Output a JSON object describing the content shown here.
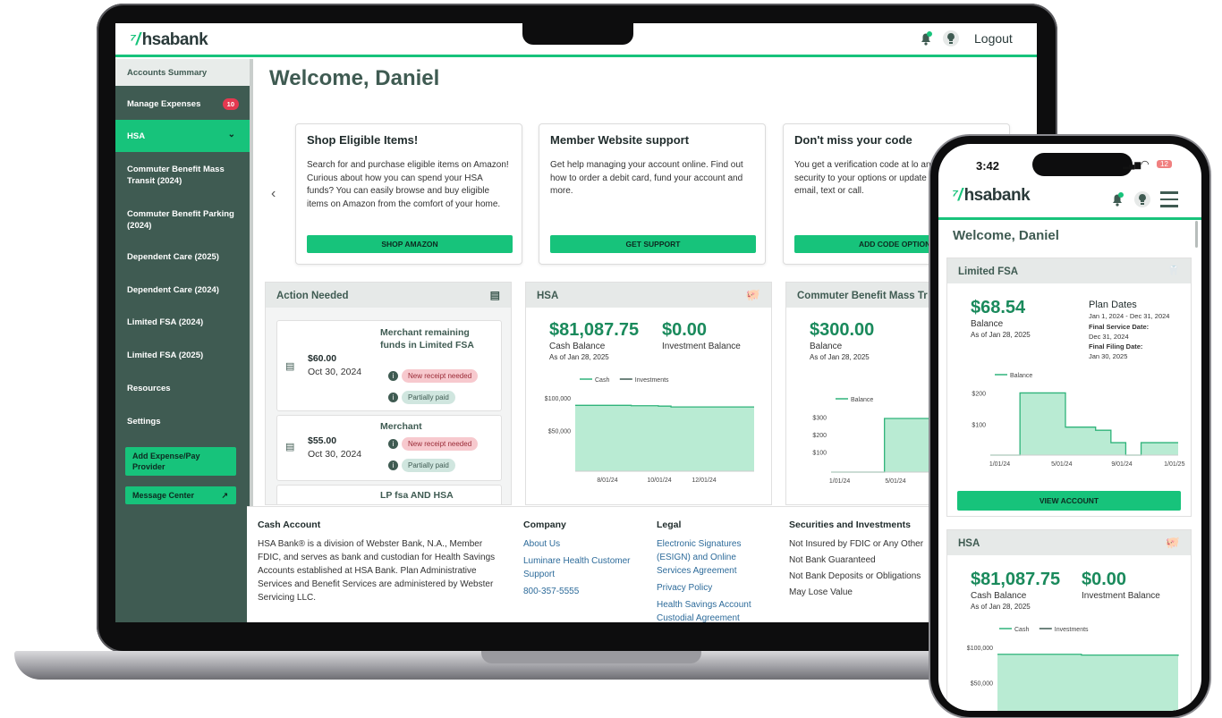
{
  "app": {
    "brand": "hsabank",
    "logout": "Logout"
  },
  "sidebar": {
    "items": [
      {
        "label": "Accounts Summary"
      },
      {
        "label": "Manage Expenses",
        "badge": "10"
      },
      {
        "label": "HSA"
      },
      {
        "label": "Commuter Benefit Mass Transit (2024)"
      },
      {
        "label": "Commuter Benefit Parking (2024)"
      },
      {
        "label": "Dependent Care (2025)"
      },
      {
        "label": "Dependent Care (2024)"
      },
      {
        "label": "Limited FSA (2024)"
      },
      {
        "label": "Limited FSA (2025)"
      },
      {
        "label": "Resources"
      },
      {
        "label": "Settings"
      }
    ],
    "add_expense": "Add Expense/Pay Provider",
    "message_center": "Message Center"
  },
  "main": {
    "welcome": "Welcome, Daniel",
    "promos": [
      {
        "title": "Shop Eligible Items!",
        "body": "Search for and purchase eligible items on Amazon! Curious about how you can spend your HSA funds? You can easily browse and buy eligible items on Amazon from the comfort of your home.",
        "button": "SHOP AMAZON"
      },
      {
        "title": "Member Website support",
        "body": "Get help managing your account online. Find out how to order a debit card, fund your account and more.",
        "button": "GET SUPPORT"
      },
      {
        "title": "Don't miss your code",
        "body": "You get a verification code at lo another layer of security to your options or update how you get y email, text or call.",
        "button": "ADD CODE OPTIONS"
      }
    ],
    "action_needed": {
      "title": "Action Needed",
      "items": [
        {
          "amount": "$60.00",
          "date": "Oct 30, 2024",
          "merchant": "Merchant remaining funds in Limited FSA",
          "tag1": "New receipt needed",
          "tag2": "Partially paid"
        },
        {
          "amount": "$55.00",
          "date": "Oct 30, 2024",
          "merchant": "Merchant",
          "tag1": "New receipt needed",
          "tag2": "Partially paid"
        },
        {
          "merchant": "LP fsa AND HSA"
        }
      ]
    },
    "hsa": {
      "title": "HSA",
      "cash": "$81,087.75",
      "cash_label": "Cash Balance",
      "asof": "As of Jan 28, 2025",
      "invest": "$0.00",
      "invest_label": "Investment Balance"
    },
    "commuter": {
      "title": "Commuter Benefit Mass Tr",
      "balance": "$300.00",
      "balance_label": "Balance",
      "asof": "As of Jan 28, 2025"
    }
  },
  "footer": {
    "cash_account": {
      "title": "Cash Account",
      "text": "HSA Bank® is a division of Webster Bank, N.A., Member FDIC, and serves as bank and custodian for Health Savings Accounts established at HSA Bank. Plan Administrative Services and Benefit Services are administered by Webster Servicing LLC."
    },
    "company": {
      "title": "Company",
      "links": [
        "About Us",
        "Luminare Health Customer Support",
        "800-357-5555"
      ]
    },
    "legal": {
      "title": "Legal",
      "links": [
        "Electronic Signatures (ESIGN) and Online Services Agreement",
        "Privacy Policy",
        "Health Savings Account Custodial Agreement"
      ]
    },
    "securities": {
      "title": "Securities and Investments",
      "lines": [
        "Not Insured by FDIC or Any Other",
        "Not Bank Guaranteed",
        "Not Bank Deposits or Obligations",
        "May Lose Value"
      ]
    }
  },
  "phone": {
    "time": "3:42",
    "battery": "12",
    "welcome": "Welcome, Daniel",
    "limited_fsa": {
      "title": "Limited FSA",
      "balance": "$68.54",
      "balance_label": "Balance",
      "asof": "As of Jan 28, 2025",
      "plan_dates_title": "Plan Dates",
      "plan_dates": "Jan 1, 2024 - Dec 31, 2024",
      "final_service_label": "Final Service Date:",
      "final_service": "Dec 31, 2024",
      "final_filing_label": "Final Filing Date:",
      "final_filing": "Jan 30, 2025",
      "button": "VIEW ACCOUNT"
    },
    "hsa": {
      "title": "HSA",
      "cash": "$81,087.75",
      "cash_label": "Cash Balance",
      "asof": "As of Jan 28, 2025",
      "invest": "$0.00",
      "invest_label": "Investment Balance"
    }
  },
  "colors": {
    "accent": "#17c37b",
    "sidebar": "#3f5b52",
    "money": "#1a8a5c"
  },
  "chart_data": [
    {
      "type": "area",
      "legend": [
        "Cash",
        "Investments"
      ],
      "yticks": [
        "$100,000",
        "$50,000"
      ],
      "xticks": [
        "8/01/24",
        "10/01/24",
        "12/01/24"
      ],
      "ylim": [
        0,
        100000
      ],
      "series": [
        {
          "name": "Cash",
          "x": [
            "7/01/24",
            "8/01/24",
            "9/01/24",
            "10/01/24",
            "10/15/24",
            "11/01/24",
            "12/01/24",
            "1/15/25"
          ],
          "values": [
            81000,
            81000,
            80500,
            80000,
            79000,
            79000,
            79000,
            79000
          ]
        }
      ]
    },
    {
      "type": "area",
      "legend": [
        "Balance"
      ],
      "yticks": [
        "$300",
        "$200",
        "$100"
      ],
      "xticks": [
        "1/01/24",
        "5/01/24",
        "9/0"
      ],
      "ylim": [
        0,
        350
      ],
      "series": [
        {
          "name": "Balance",
          "x": [
            "1/01/24",
            "3/01/24",
            "4/01/24",
            "9/01/24"
          ],
          "values": [
            0,
            0,
            300,
            300
          ]
        }
      ]
    },
    {
      "type": "area",
      "legend": [
        "Balance"
      ],
      "yticks": [
        "$200",
        "$100"
      ],
      "xticks": [
        "1/01/24",
        "5/01/24",
        "9/01/24",
        "1/01/25"
      ],
      "ylim": [
        0,
        230
      ],
      "series": [
        {
          "name": "Balance",
          "x": [
            "1/01/24",
            "3/01/24",
            "5/01/24",
            "6/01/24",
            "8/01/24",
            "9/01/24",
            "10/01/24",
            "11/01/24",
            "12/01/24"
          ],
          "values": [
            0,
            200,
            200,
            90,
            80,
            40,
            0,
            40,
            40
          ]
        }
      ]
    },
    {
      "type": "area",
      "legend": [
        "Cash",
        "Investments"
      ],
      "yticks": [
        "$100,000",
        "$50,000"
      ],
      "ylim": [
        0,
        100000
      ],
      "series": [
        {
          "name": "Cash",
          "x": [
            "7/01/24",
            "10/01/24",
            "1/15/25"
          ],
          "values": [
            81000,
            80000,
            79000
          ]
        }
      ]
    }
  ]
}
